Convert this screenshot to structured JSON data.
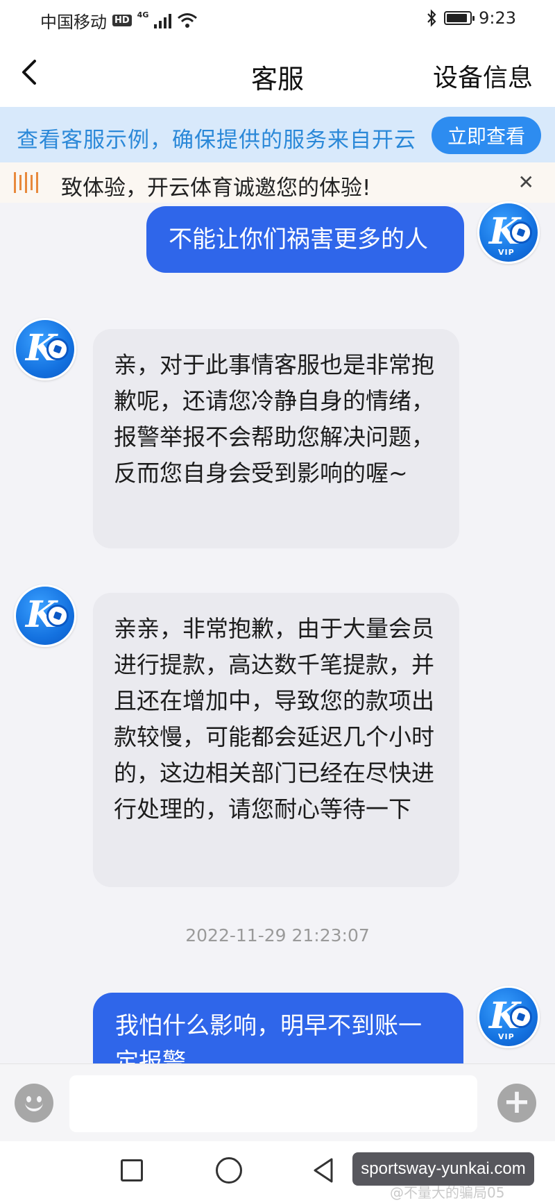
{
  "status_bar": {
    "carrier": "中国移动",
    "hd": "HD",
    "network": "4G",
    "time": "9:23",
    "battery_level_fraction": 0.9
  },
  "header": {
    "back_icon": "chevron-left-icon",
    "title": "客服",
    "right_action": "设备信息"
  },
  "banner": {
    "text": "查看客服示例，确保提供的服务来自开云",
    "button": "立即查看"
  },
  "notice": {
    "icon": "announcement-icon",
    "text": "致体验，开云体育诚邀您的体验!",
    "close_icon": "close-icon"
  },
  "messages": [
    {
      "from": "me",
      "text": "不能让你们祸害更多的人",
      "avatar_vip": "VIP"
    },
    {
      "from": "agent",
      "text": "亲，对于此事情客服也是非常抱歉呢，还请您冷静自身的情绪，报警举报不会帮助您解决问题，反而您自身会受到影响的喔~"
    },
    {
      "from": "agent",
      "text": "亲亲，非常抱歉，由于大量会员进行提款，高达数千笔提款，并且还在增加中，导致您的款项出款较慢，可能都会延迟几个小时的，这边相关部门已经在尽快进行处理的，请您耐心等待一下"
    },
    {
      "from": "me",
      "text": "我怕什么影响，明早不到账一定报警",
      "avatar_vip": "VIP"
    }
  ],
  "timestamp": "2022-11-29 21:23:07",
  "input_bar": {
    "emoji_icon": "emoji-icon",
    "placeholder": "",
    "plus_icon": "plus-icon"
  },
  "watermark": {
    "text": "sportsway-yunkai.com",
    "sub": "@不量大的骗局05"
  }
}
